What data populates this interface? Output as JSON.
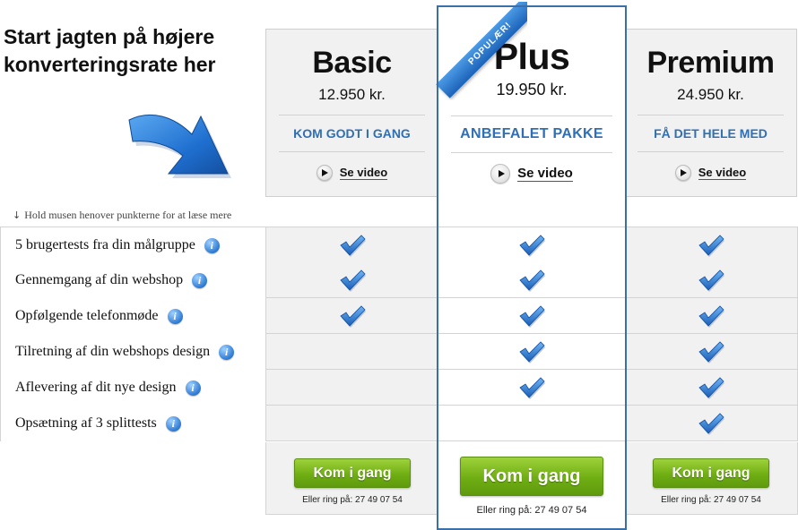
{
  "headline": "Start jagten på højere konverteringsrate her",
  "ribbon_label": "POPULÆR!",
  "plans": {
    "basic": {
      "name": "Basic",
      "price": "12.950 kr.",
      "tagline": "KOM GODT I GANG",
      "video_label": "Se video",
      "cta_label": "Kom i gang",
      "phone": "Eller ring på: 27 49 07 54"
    },
    "plus": {
      "name": "Plus",
      "price": "19.950 kr.",
      "tagline": "ANBEFALET PAKKE",
      "video_label": "Se video",
      "cta_label": "Kom i gang",
      "phone": "Eller ring på: 27 49 07 54"
    },
    "premium": {
      "name": "Premium",
      "price": "24.950 kr.",
      "tagline": "FÅ DET HELE MED",
      "video_label": "Se video",
      "cta_label": "Kom i gang",
      "phone": "Eller ring på: 27 49 07 54"
    }
  },
  "hint": "Hold musen henover punkterne for at læse mere",
  "features": [
    {
      "label": "5 brugertests fra din målgruppe",
      "basic": true,
      "plus": true,
      "premium": true
    },
    {
      "label": "Gennemgang af din webshop",
      "basic": true,
      "plus": true,
      "premium": true
    },
    {
      "label": "Opfølgende telefonmøde",
      "basic": true,
      "plus": true,
      "premium": true
    },
    {
      "label": "Tilretning af din webshops design",
      "basic": false,
      "plus": true,
      "premium": true
    },
    {
      "label": "Aflevering af dit nye design",
      "basic": false,
      "plus": true,
      "premium": true
    },
    {
      "label": "Opsætning af 3 splittests",
      "basic": false,
      "plus": false,
      "premium": true
    }
  ],
  "icons": {
    "info": "info-icon",
    "check": "checkmark-icon",
    "play": "play-icon",
    "arrow": "arrow-icon",
    "hint": "down-arrow-icon"
  },
  "colors": {
    "accent_blue": "#2f6fb3",
    "cta_green": "#6fae13",
    "plus_border": "#3a6fa8",
    "column_bg": "#f1f1f1"
  }
}
